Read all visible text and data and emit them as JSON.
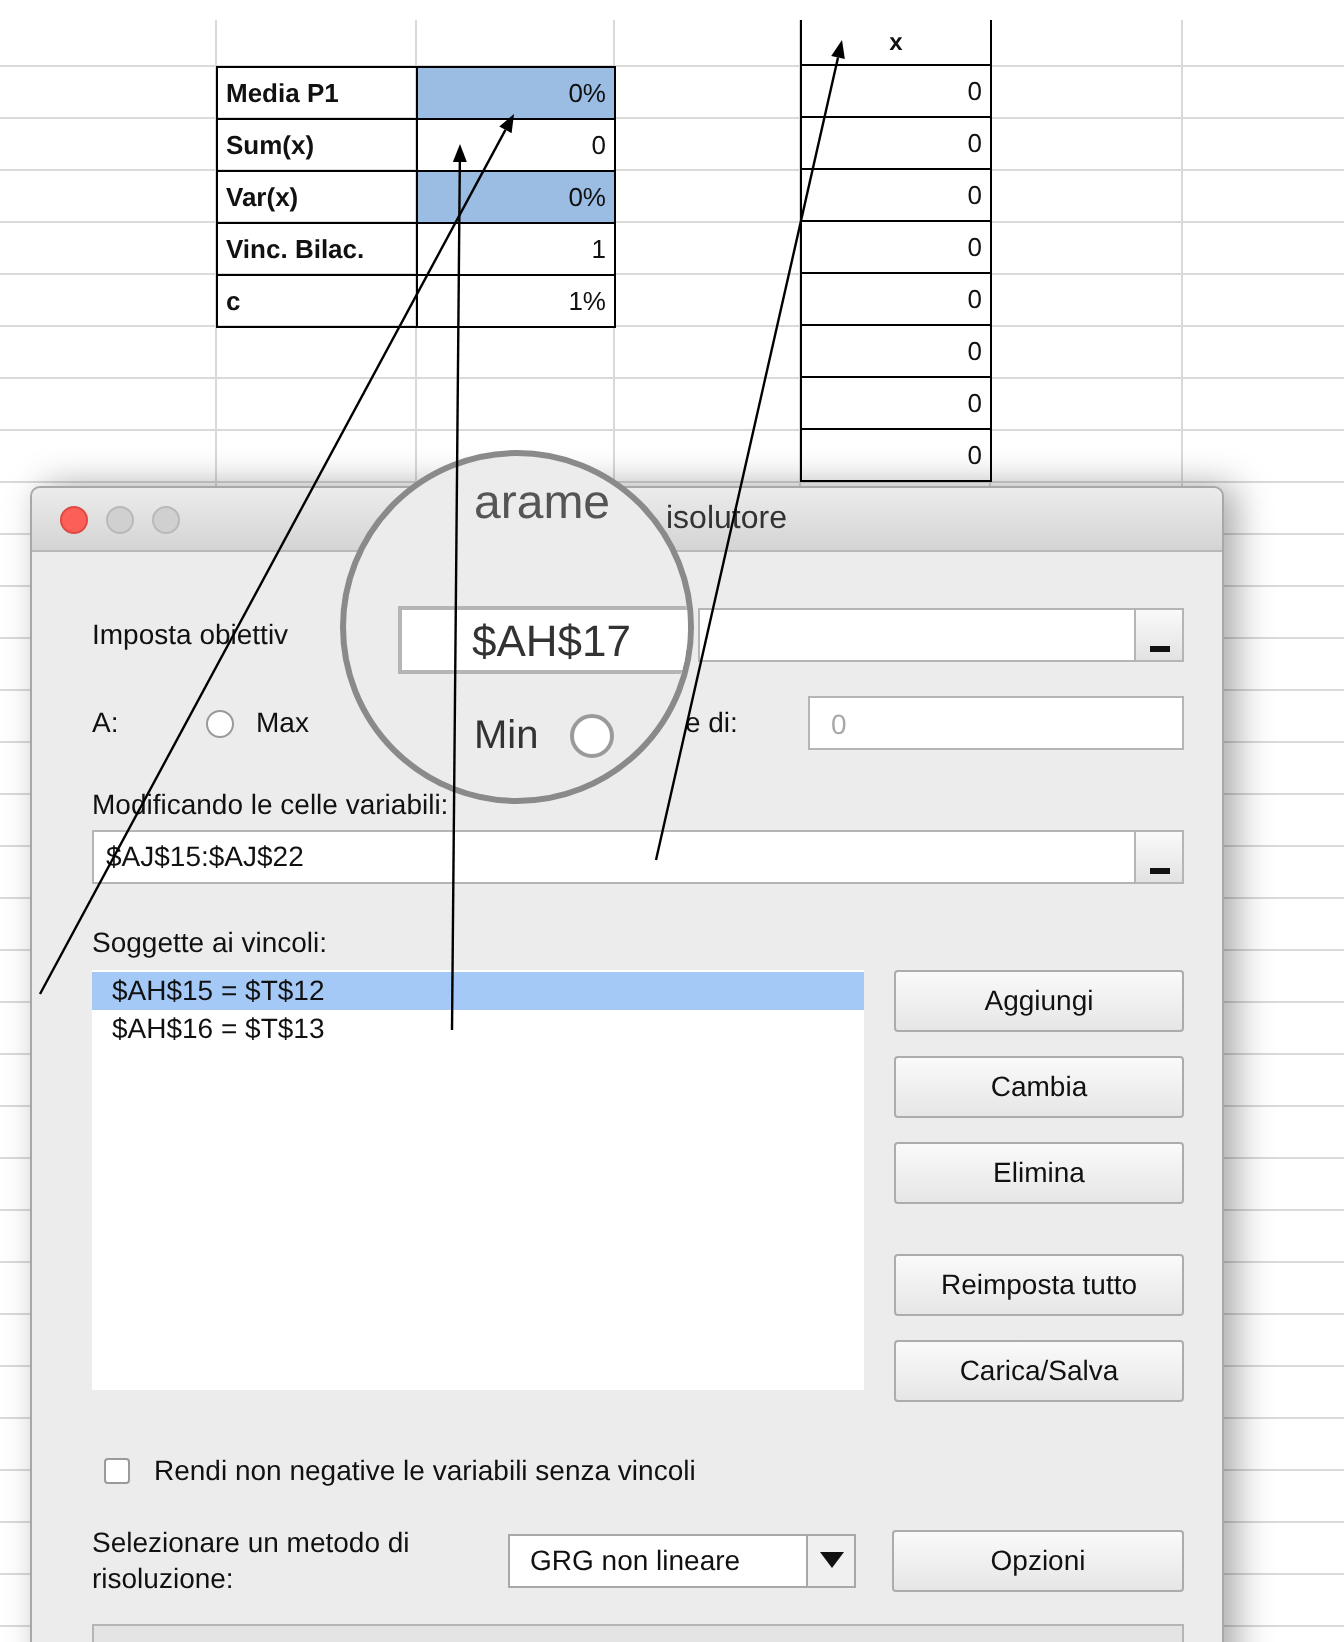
{
  "sheet": {
    "summary_rows": [
      {
        "label": "Media P1",
        "value": "0%",
        "highlighted": true
      },
      {
        "label": "Sum(x)",
        "value": "0",
        "highlighted": false
      },
      {
        "label": "Var(x)",
        "value": "0%",
        "highlighted": true
      },
      {
        "label": "Vinc. Bilac.",
        "value": "1",
        "highlighted": false
      },
      {
        "label": "c",
        "value": "1%",
        "highlighted": false
      }
    ],
    "x_column": {
      "header": "x",
      "values": [
        "0",
        "0",
        "0",
        "0",
        "0",
        "0",
        "0",
        "0"
      ]
    }
  },
  "dialog": {
    "title": "isolutore",
    "objective": {
      "label": "Imposta obiettiv"
    },
    "to": {
      "label": "A:",
      "max": {
        "label": "Max",
        "selected": false
      },
      "value_label": "e di:",
      "placeholder": "0"
    },
    "variable_cells": {
      "label": "Modificando le celle variabili:",
      "value": "$AJ$15:$AJ$22"
    },
    "constraints": {
      "label": "Soggette ai vincoli:",
      "items": [
        {
          "text": "$AH$15 = $T$12",
          "selected": true
        },
        {
          "text": "$AH$16 = $T$13",
          "selected": false
        }
      ]
    },
    "buttons": [
      "Aggiungi",
      "Cambia",
      "Elimina",
      "Reimposta tutto",
      "Carica/Salva"
    ],
    "nonnegative": {
      "label": "Rendi non negative le variabili senza vincoli",
      "checked": false
    },
    "method": {
      "label": "Selezionare un metodo di risoluzione:",
      "value": "GRG non lineare"
    },
    "options_button": "Opzioni"
  },
  "magnifier": {
    "title_fragment": "arame",
    "objective_value": "$AH$17",
    "min": {
      "label": "Min",
      "selected": false
    }
  }
}
